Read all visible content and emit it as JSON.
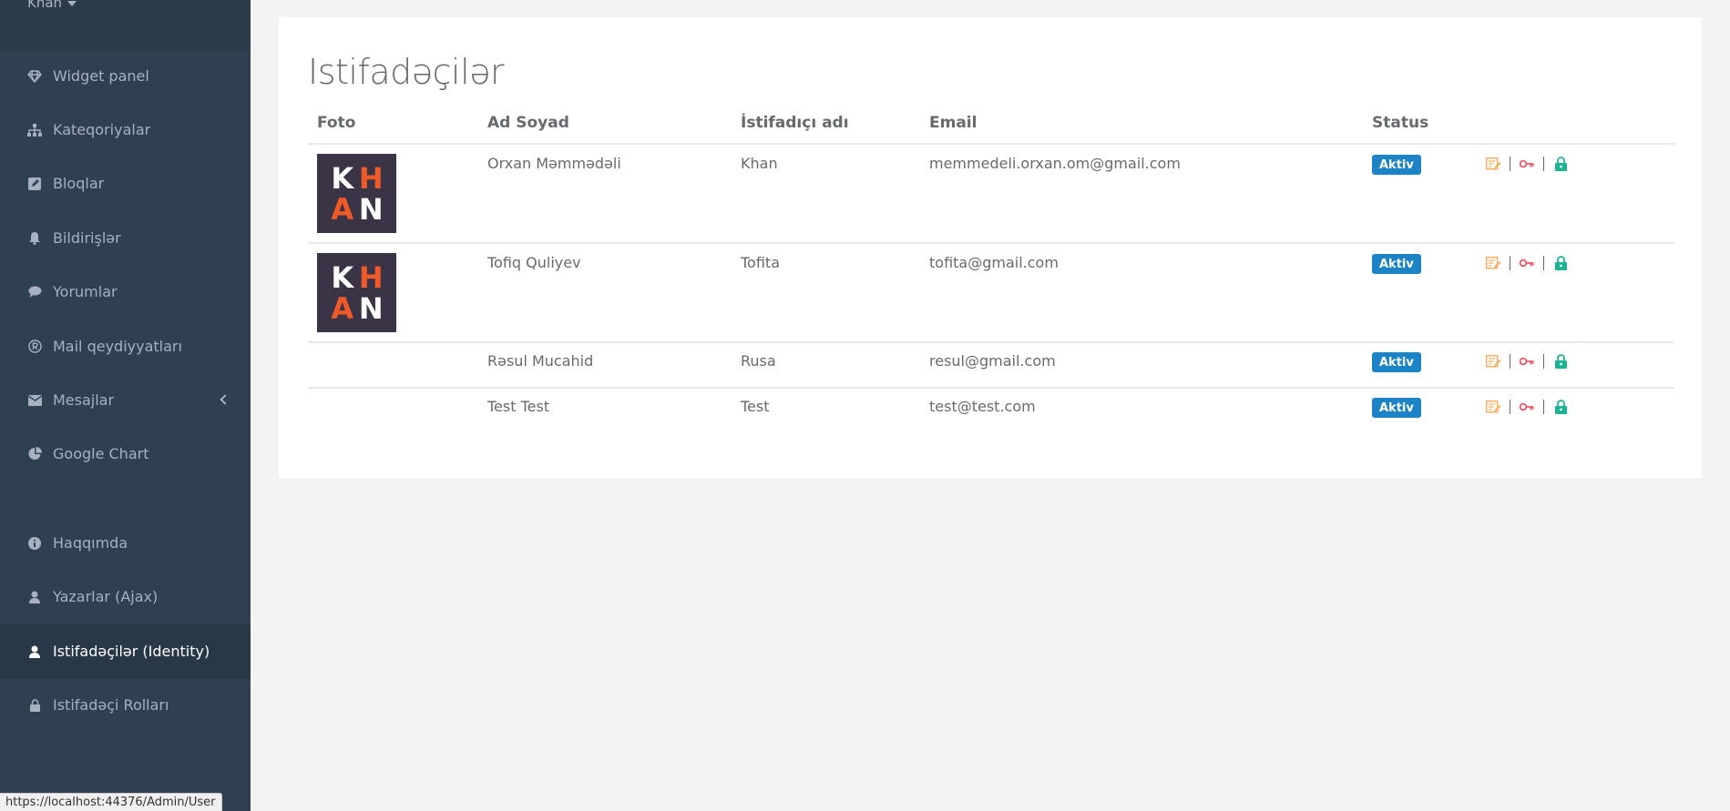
{
  "sidebar": {
    "user": "Khan",
    "items": [
      {
        "label": "Widget panel",
        "icon": "diamond-icon"
      },
      {
        "label": "Kateqoriyalar",
        "icon": "sitemap-icon"
      },
      {
        "label": "Bloqlar",
        "icon": "edit-icon"
      },
      {
        "label": "Bildirişlər",
        "icon": "bell-icon"
      },
      {
        "label": "Yorumlar",
        "icon": "comment-icon"
      },
      {
        "label": "Mail qeydiyyatları",
        "icon": "registered-icon"
      },
      {
        "label": "Mesajlar",
        "icon": "envelope-icon"
      },
      {
        "label": "Google Chart",
        "icon": "pie-chart-icon"
      },
      {
        "label": "Haqqımda",
        "icon": "info-icon"
      },
      {
        "label": "Yazarlar (Ajax)",
        "icon": "user-icon"
      },
      {
        "label": "Istifadəçilər (Identity)",
        "icon": "user-icon"
      },
      {
        "label": "Istifadəçi Rolları",
        "icon": "lock-icon"
      }
    ]
  },
  "main": {
    "title": "Istifadəçilər",
    "columns": [
      "Foto",
      "Ad Soyad",
      "İstifadıçı adı",
      "Email",
      "Status"
    ],
    "rows": [
      {
        "name": "Orxan Məmmədəli",
        "username": "Khan",
        "email": "memmedeli.orxan.om@gmail.com",
        "status": "Aktiv",
        "has_photo": true
      },
      {
        "name": "Tofiq Quliyev",
        "username": "Tofita",
        "email": "tofita@gmail.com",
        "status": "Aktiv",
        "has_photo": true
      },
      {
        "name": "Rəsul Mucahid",
        "username": "Rusa",
        "email": "resul@gmail.com",
        "status": "Aktiv",
        "has_photo": false
      },
      {
        "name": "Test Test",
        "username": "Test",
        "email": "test@test.com",
        "status": "Aktiv",
        "has_photo": false
      }
    ],
    "avatar_letters": [
      "K",
      "H",
      "A",
      "N"
    ]
  },
  "statusbar": {
    "url": "https://localhost:44376/Admin/User"
  },
  "colors": {
    "sidebar": "#2f4050",
    "badge": "#1c84c6",
    "edit": "#f8ac59",
    "key": "#ed5565",
    "lock": "#1ab394",
    "avatar_orange": "#f05a28"
  }
}
